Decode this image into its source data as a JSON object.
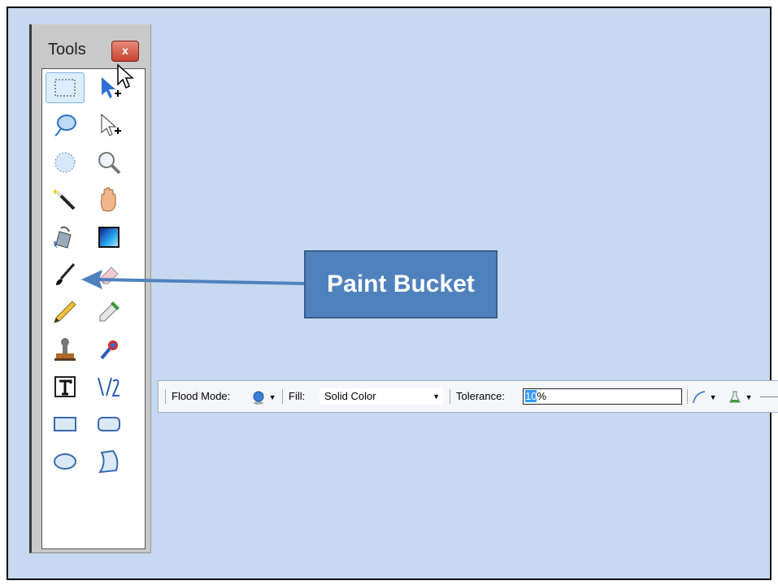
{
  "tools_window": {
    "title": "Tools",
    "close_label": "x",
    "tools": [
      {
        "name": "rectangle-select",
        "selected": true
      },
      {
        "name": "move-selected-pixels"
      },
      {
        "name": "lasso-select"
      },
      {
        "name": "move-selection"
      },
      {
        "name": "ellipse-select"
      },
      {
        "name": "zoom"
      },
      {
        "name": "magic-wand"
      },
      {
        "name": "pan"
      },
      {
        "name": "paint-bucket"
      },
      {
        "name": "gradient"
      },
      {
        "name": "paintbrush"
      },
      {
        "name": "eraser"
      },
      {
        "name": "pencil"
      },
      {
        "name": "color-picker"
      },
      {
        "name": "clone-stamp"
      },
      {
        "name": "recolor"
      },
      {
        "name": "text"
      },
      {
        "name": "line-curve"
      },
      {
        "name": "rectangle"
      },
      {
        "name": "rounded-rectangle"
      },
      {
        "name": "ellipse"
      },
      {
        "name": "freeform-shape"
      }
    ]
  },
  "callout": {
    "label": "Paint Bucket"
  },
  "toolbar": {
    "flood_mode_label": "Flood Mode:",
    "fill_label": "Fill:",
    "fill_value": "Solid Color",
    "tolerance_label": "Tolerance:",
    "tolerance_selected": "10",
    "tolerance_rest": "%"
  },
  "colors": {
    "slide_bg": "#c6d9f0",
    "callout_bg": "#4f81bd",
    "arrow": "#4f81bd",
    "selection_highlight": "#3399ff"
  }
}
